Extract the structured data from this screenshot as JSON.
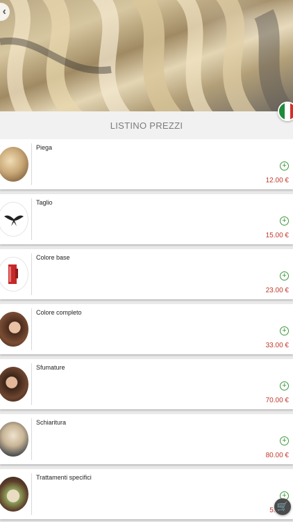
{
  "header": {
    "title": "LISTINO PREZZI",
    "back_icon": "chevron-left-icon",
    "flag": [
      "#1f8a3a",
      "#ffffff",
      "#d22f27"
    ]
  },
  "colors": {
    "price": "#c0392b",
    "add": "#3b9a3b",
    "title": "#7c7c7c"
  },
  "items": [
    {
      "name": "Piega",
      "price": "12.00 €"
    },
    {
      "name": "Taglio",
      "price": "15.00 €"
    },
    {
      "name": "Colore base",
      "price": "23.00 €"
    },
    {
      "name": "Colore completo",
      "price": "33.00 €"
    },
    {
      "name": "Sfumature",
      "price": "70.00 €"
    },
    {
      "name": "Schiaritura",
      "price": "80.00 €"
    },
    {
      "name": "Trattamenti specifici",
      "price": "5.00 €"
    }
  ],
  "add_symbol": "+",
  "cart": {
    "icon": "cart-icon",
    "symbol": "🛒"
  }
}
